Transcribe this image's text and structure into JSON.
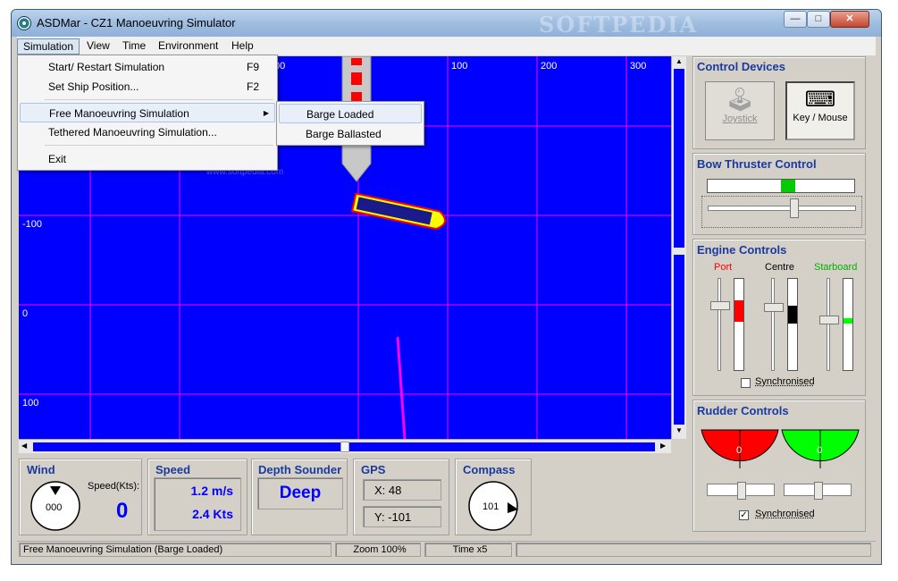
{
  "window": {
    "title": "ASDMar - CZ1 Manoeuvring Simulator",
    "watermark": "SOFTPEDIA",
    "minimize": "—",
    "maximize": "□",
    "close": "✕"
  },
  "menubar": {
    "items": [
      "Simulation",
      "View",
      "Time",
      "Environment",
      "Help"
    ]
  },
  "simulation_menu": {
    "items": [
      {
        "label": "Start/ Restart Simulation",
        "shortcut": "F9"
      },
      {
        "label": "Set Ship Position...",
        "shortcut": "F2"
      },
      {
        "label": "Free Manoeuvring Simulation",
        "shortcut": ""
      },
      {
        "label": "Tethered Manoeuvring Simulation...",
        "shortcut": ""
      },
      {
        "label": "Exit",
        "shortcut": ""
      }
    ],
    "submenu": [
      "Barge Loaded",
      "Barge Ballasted"
    ]
  },
  "map": {
    "x_labels": [
      "00",
      "100",
      "200",
      "300"
    ],
    "y_labels": [
      "-100",
      "0",
      "100"
    ],
    "watermark": "www.softpedia.com"
  },
  "control_devices": {
    "title": "Control Devices",
    "joystick": "Joystick",
    "key_mouse": "Key / Mouse"
  },
  "bow_thruster": {
    "title": "Bow Thruster Control"
  },
  "engine_controls": {
    "title": "Engine Controls",
    "port": "Port",
    "centre": "Centre",
    "starboard": "Starboard",
    "synchronised": "Synchronised"
  },
  "rudder_controls": {
    "title": "Rudder Controls",
    "left_value": "0",
    "right_value": "0",
    "synchronised": "Synchronised"
  },
  "wind": {
    "title": "Wind",
    "direction": "000",
    "speed_label": "Speed(Kts):",
    "speed_value": "0"
  },
  "speed": {
    "title": "Speed",
    "ms": "1.2 m/s",
    "kts": "2.4 Kts"
  },
  "depth": {
    "title": "Depth Sounder",
    "value": "Deep"
  },
  "gps": {
    "title": "GPS",
    "x": "X: 48",
    "y": "Y: -101"
  },
  "compass": {
    "title": "Compass",
    "heading": "101"
  },
  "status": {
    "mode": "Free Manoeuvring Simulation (Barge Loaded)",
    "zoom": "Zoom 100%",
    "time": "Time x5"
  },
  "colors": {
    "sea": "#0000ff",
    "grid": "#ff00ff",
    "ship_hull": "#ff0000",
    "port_green": "#00ff00"
  }
}
